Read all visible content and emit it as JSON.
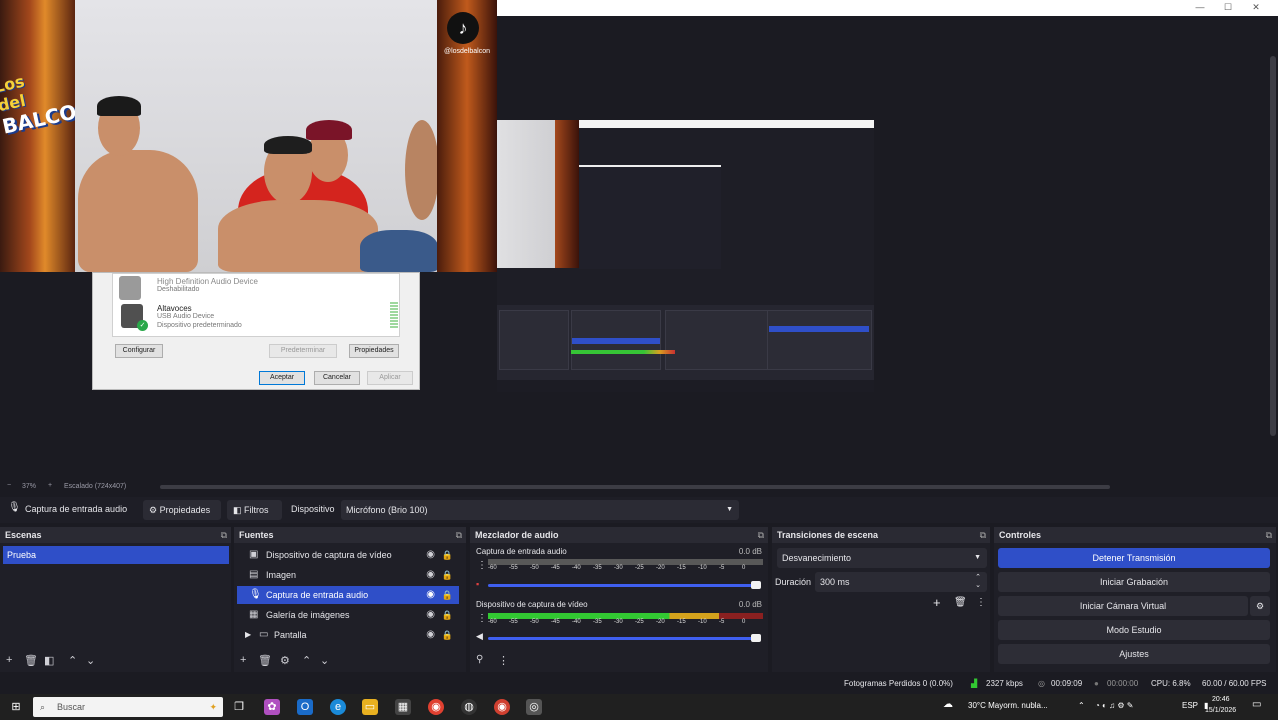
{
  "preview": {
    "tiktok_handle": "@losdelbalcon",
    "logo_line1": "Los del",
    "logo_line2": "BALCON"
  },
  "sound_dialog": {
    "device1_name": "High Definition Audio Device",
    "device1_status": "Deshabilitado",
    "device2_name": "Altavoces",
    "device2_sub": "USB Audio Device",
    "device2_status": "Dispositivo predeterminado",
    "configurar": "Configurar",
    "predeterminar": "Predeterminar",
    "propiedades": "Propiedades",
    "aceptar": "Aceptar",
    "cancelar": "Cancelar",
    "aplicar": "Aplicar"
  },
  "zoom": {
    "minus": "−",
    "percent": "37%",
    "plus": "+",
    "scaled": "Escalado (724x407)"
  },
  "context_bar": {
    "source_name": "Captura de entrada audio",
    "propiedades": "Propiedades",
    "filtros": "Filtros",
    "dispositivo_label": "Dispositivo",
    "dispositivo_value": "Micrófono (Brio 100)"
  },
  "escenas": {
    "title": "Escenas",
    "items": [
      "Prueba"
    ]
  },
  "fuentes": {
    "title": "Fuentes",
    "items": [
      {
        "label": "Dispositivo de captura de vídeo",
        "icon": "camera-icon"
      },
      {
        "label": "Imagen",
        "icon": "image-icon"
      },
      {
        "label": "Captura de entrada audio",
        "icon": "microphone-icon"
      },
      {
        "label": "Galería de imágenes",
        "icon": "gallery-icon"
      },
      {
        "label": "Pantalla",
        "icon": "folder-icon"
      }
    ]
  },
  "mezclador": {
    "title": "Mezclador de audio",
    "channels": [
      {
        "name": "Captura de entrada audio",
        "db": "0.0 dB",
        "level": 0
      },
      {
        "name": "Dispositivo de captura de vídeo",
        "db": "0.0 dB",
        "level": 1
      }
    ],
    "ticks": [
      "-60",
      "-55",
      "-50",
      "-45",
      "-40",
      "-35",
      "-30",
      "-25",
      "-20",
      "-15",
      "-10",
      "-5",
      "0"
    ]
  },
  "transiciones": {
    "title": "Transiciones de escena",
    "selected": "Desvanecimiento",
    "duracion_label": "Duración",
    "duracion_value": "300 ms"
  },
  "controles": {
    "title": "Controles",
    "detener": "Detener Transmisión",
    "grabacion": "Iniciar Grabación",
    "camara_virtual": "Iniciar Cámara Virtual",
    "modo_estudio": "Modo Estudio",
    "ajustes": "Ajustes"
  },
  "status": {
    "dropped": "Fotogramas Perdidos 0 (0.0%)",
    "bitrate": "2327 kbps",
    "stream_time": "00:09:09",
    "rec_time": "00:00:00",
    "cpu": "CPU: 6.8%",
    "fps": "60.00 / 60.00 FPS"
  },
  "taskbar": {
    "search_placeholder": "Buscar",
    "weather": "30°C  Mayorm. nubla...",
    "lang": "ESP",
    "time": "20:46",
    "date": "15/1/2026"
  }
}
